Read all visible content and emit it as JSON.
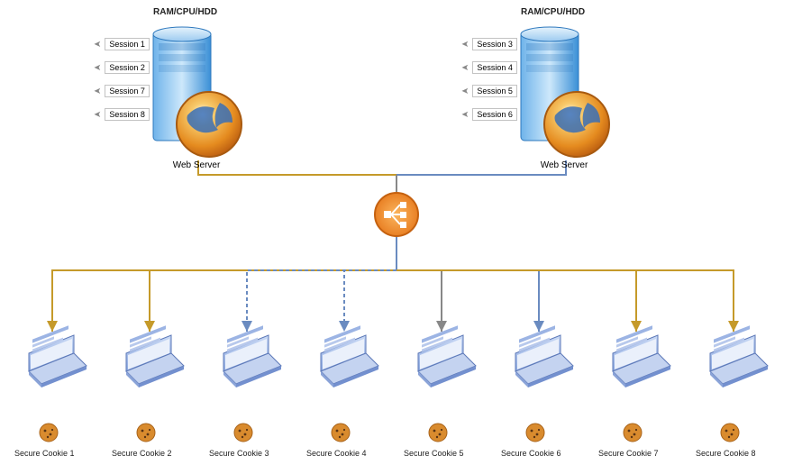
{
  "servers": [
    {
      "label": "Web Server",
      "resources": "RAM/CPU/HDD",
      "sessions": [
        "Session 1",
        "Session 2",
        "Session 7",
        "Session 8"
      ]
    },
    {
      "label": "Web Server",
      "resources": "RAM/CPU/HDD",
      "sessions": [
        "Session 3",
        "Session 4",
        "Session 5",
        "Session 6"
      ]
    }
  ],
  "load_balancer": {
    "icon": "load-balancer-icon"
  },
  "connector_styles": {
    "server1_to_lb": "gold-solid",
    "server2_to_lb": "blue-solid",
    "lb_to_clients": [
      "gold-solid",
      "gold-solid",
      "blue-dotted",
      "blue-dotted",
      "gray-solid",
      "blue-solid",
      "gold-solid",
      "gold-solid"
    ]
  },
  "clients": [
    {
      "cookie": "Secure Cookie 1"
    },
    {
      "cookie": "Secure Cookie 2"
    },
    {
      "cookie": "Secure Cookie 3"
    },
    {
      "cookie": "Secure Cookie 4"
    },
    {
      "cookie": "Secure Cookie 5"
    },
    {
      "cookie": "Secure Cookie 6"
    },
    {
      "cookie": "Secure Cookie 7"
    },
    {
      "cookie": "Secure Cookie 8"
    }
  ],
  "colors": {
    "gold": "#c59a2a",
    "blue": "#6a8bc0",
    "gray": "#888888",
    "orange": "#e57518"
  }
}
